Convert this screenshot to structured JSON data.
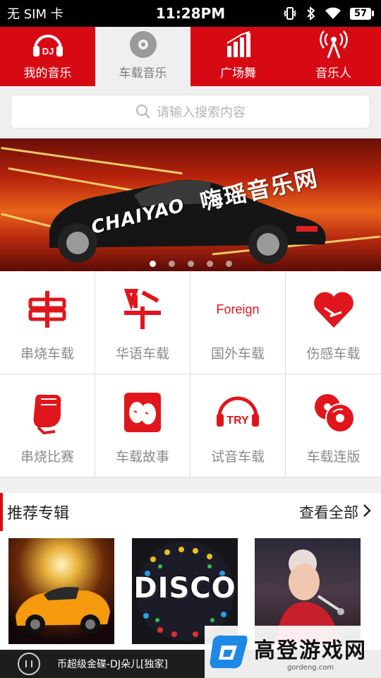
{
  "status_bar": {
    "carrier": "无 SIM 卡",
    "time": "11:28PM",
    "battery": "57"
  },
  "top_tabs": [
    {
      "label": "我的音乐",
      "icon": "dj-headphones-icon",
      "active": false
    },
    {
      "label": "车载音乐",
      "icon": "disc-icon",
      "active": true
    },
    {
      "label": "广场舞",
      "icon": "bar-chart-icon",
      "active": false
    },
    {
      "label": "音乐人",
      "icon": "antenna-icon",
      "active": false
    }
  ],
  "search": {
    "placeholder": "请输入搜索内容"
  },
  "banner": {
    "title": "嗨瑶音乐网",
    "logo": "CHAIYAO",
    "slide_count": 5,
    "active_index": 0
  },
  "categories": [
    {
      "label": "串烧车载",
      "icon": "chuan-icon"
    },
    {
      "label": "华语车载",
      "icon": "hua-icon"
    },
    {
      "label": "国外车载",
      "icon": "foreign-icon",
      "icon_text": "Foreign"
    },
    {
      "label": "伤感车载",
      "icon": "broken-heart-icon"
    },
    {
      "label": "串烧比赛",
      "icon": "fist-icon"
    },
    {
      "label": "车载故事",
      "icon": "faces-icon"
    },
    {
      "label": "试音车载",
      "icon": "try-headphones-icon",
      "icon_text": "TRY"
    },
    {
      "label": "车载连版",
      "icon": "discs-icon"
    }
  ],
  "recommended": {
    "title": "推荐专辑",
    "more_label": "查看全部"
  },
  "albums": [
    {
      "name": "sports-car-album"
    },
    {
      "name": "disco-album",
      "cover_text": "DISCO"
    },
    {
      "name": "singer-album"
    }
  ],
  "player": {
    "track": "币超级金碟-DJ朵儿[独家]"
  },
  "watermark": {
    "title": "高登游戏网",
    "url": "gordeng.com"
  },
  "colors": {
    "brand_red": "#d70a14",
    "tab_active_bg": "#efefef",
    "label_gray": "#8a8a8a"
  }
}
